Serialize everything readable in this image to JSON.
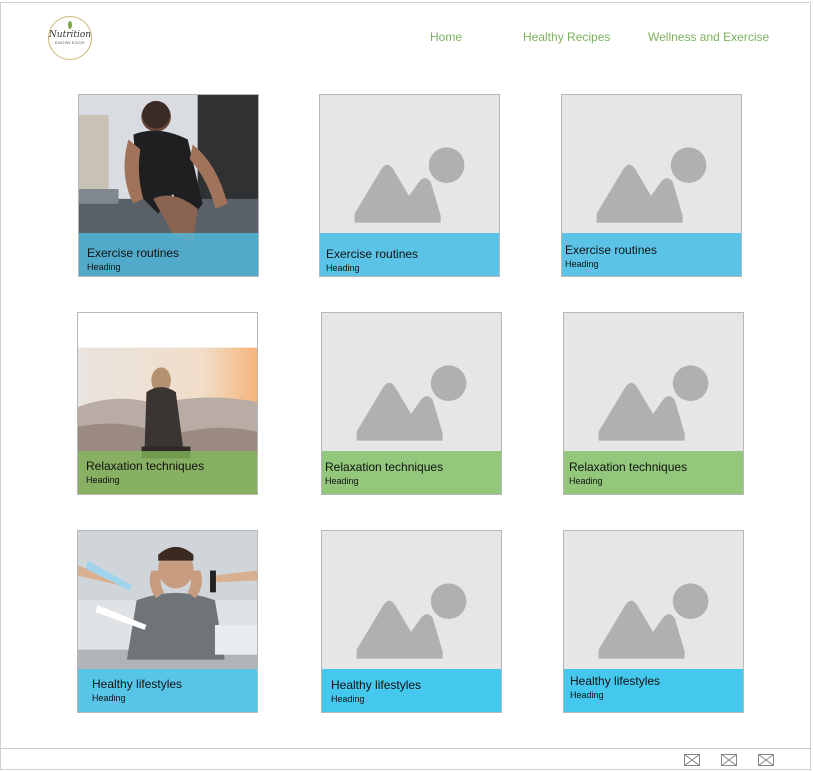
{
  "logo": {
    "text": "Nutrition",
    "subtext": "KNOWLEDGE"
  },
  "nav": {
    "items": [
      {
        "label": "Home"
      },
      {
        "label": "Healthy Recipes"
      },
      {
        "label": "Wellness and Exercise"
      }
    ]
  },
  "cards": [
    {
      "title": "Exercise routines",
      "heading": "Heading",
      "image": "athlete-photo"
    },
    {
      "title": "Exercise routines",
      "heading": "Heading",
      "image": "image-placeholder"
    },
    {
      "title": "Exercise routines",
      "heading": "Heading",
      "image": "image-placeholder"
    },
    {
      "title": "Relaxation techniques",
      "heading": "Heading",
      "image": "woman-landscape-photo"
    },
    {
      "title": "Relaxation techniques",
      "heading": "Heading",
      "image": "image-placeholder"
    },
    {
      "title": "Relaxation techniques",
      "heading": "Heading",
      "image": "image-placeholder"
    },
    {
      "title": "Healthy lifestyles",
      "heading": "Heading",
      "image": "stressed-man-photo"
    },
    {
      "title": "Healthy lifestyles",
      "heading": "Heading",
      "image": "image-placeholder"
    },
    {
      "title": "Healthy lifestyles",
      "heading": "Heading",
      "image": "image-placeholder"
    }
  ],
  "footer": {
    "icons": [
      "image-icon",
      "image-icon",
      "image-icon"
    ]
  },
  "colors": {
    "nav": "#7bb05e",
    "blue_band": "#5bc4e6",
    "green_band": "#93c77b",
    "placeholder": "#e6e6e6"
  }
}
